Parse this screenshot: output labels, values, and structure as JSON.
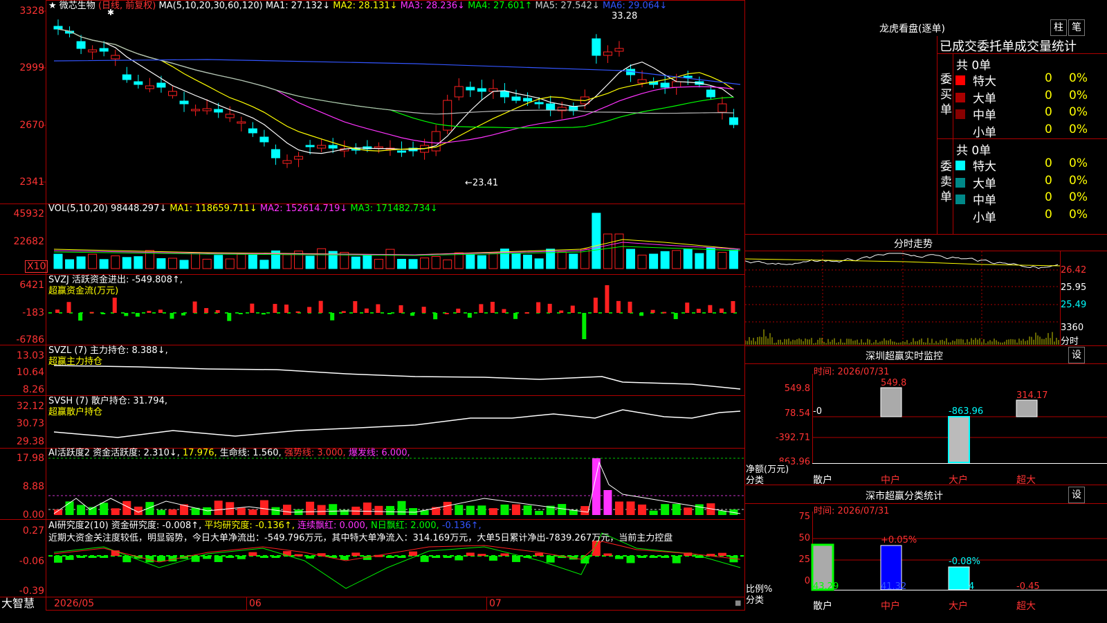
{
  "colors": {
    "up": "#ff2020",
    "down": "#00ffff",
    "grid": "#b00000",
    "green": "#00ff00",
    "yellow": "#ffff00",
    "magenta": "#ff33ff",
    "white": "#ffffff"
  },
  "kline": {
    "title": "微芯生物",
    "mode": "(日线, 前复权)",
    "ma_label": "MA(5,10,20,30,60,120)",
    "ma1": "MA1: 27.132↓",
    "ma2": "MA2: 28.131↓",
    "ma3": "MA3: 28.236↓",
    "ma4": "MA4: 27.601↑",
    "ma5": "MA5: 27.542↓",
    "ma6": "MA6: 29.064↓",
    "y_ticks": [
      "3328",
      "2999",
      "2670",
      "2341"
    ],
    "high_mark": "33.28",
    "low_mark": "←23.41"
  },
  "volume": {
    "label": "VOL(5,10,20)",
    "value": "98448.297↓",
    "ma1": "MA1: 118659.711↓",
    "ma2": "MA2: 152614.719↓",
    "ma3": "MA3: 171482.734↓",
    "y_ticks": [
      "45932",
      "22682"
    ],
    "unit": "X10"
  },
  "fund_flow": {
    "label": "SVZJ  活跃资金进出: -549.808↑,",
    "sub": "超赢资金流(万元)",
    "y_ticks": [
      "6421",
      "-183",
      "-6786"
    ]
  },
  "main_pos": {
    "label": "SVZL (7) 主力持仓: 8.388↓,",
    "sub": "超赢主力持仓",
    "y_ticks": [
      "13.03",
      "10.64",
      "8.26"
    ]
  },
  "retail_pos": {
    "label": "SVSH (7) 散户持仓: 31.794,",
    "sub": "超赢散户持仓",
    "y_ticks": [
      "32.12",
      "30.73",
      "29.38"
    ]
  },
  "activity": {
    "a": "AI活跃度2 资金活跃度: 2.310↓,",
    "b": "17.976,",
    "c": "生命线: 1.560,",
    "d": "强势线: 3.000,",
    "e": "爆发线: 6.000,",
    "y_ticks": [
      "17.98",
      "8.88",
      "0.00"
    ]
  },
  "research": {
    "a": "AI研究度2(10) 资金研究度: -0.008↑,",
    "b": "平均研究度: -0.136↑,",
    "c": "连续飘红: 0.000,",
    "d": "N日飘红: 2.000,",
    "e": "-0.136↑,",
    "commentary": "近期大资金关注度较低，明显弱势，今日大单净流出：-549.796万元，其中特大单净流入：314.169万元，大单5日累计净出-7839.267万元，当前主力控盘",
    "y_ticks": [
      "0.27",
      "-0.06",
      "-0.39"
    ]
  },
  "bottom": {
    "brand": "大智慧",
    "dates": [
      "2026/05",
      "06",
      "07"
    ]
  },
  "dragon_tiger": {
    "title": "龙虎看盘(逐单)",
    "btn_a": "柱",
    "btn_b": "笔",
    "header": "已成交委托单成交量统计",
    "buy_label": "委买单",
    "sell_label": "委卖单",
    "buy_total": "共 0单",
    "sell_total": "共 0单",
    "buy_rows": [
      {
        "name": "特大",
        "n": "0",
        "p": "0%"
      },
      {
        "name": "大单",
        "n": "0",
        "p": "0%"
      },
      {
        "name": "中单",
        "n": "0",
        "p": "0%"
      },
      {
        "name": "小单",
        "n": "0",
        "p": "0%"
      }
    ],
    "sell_rows": [
      {
        "name": "特大",
        "n": "0",
        "p": "0%"
      },
      {
        "name": "大单",
        "n": "0",
        "p": "0%"
      },
      {
        "name": "中单",
        "n": "0",
        "p": "0%"
      },
      {
        "name": "小单",
        "n": "0",
        "p": "0%"
      }
    ]
  },
  "intraday": {
    "title": "分时走势",
    "y_ticks": [
      "26.42",
      "25.95",
      "25.49"
    ],
    "vol_label": "3360",
    "vol_unit": "分时"
  },
  "sz_monitor": {
    "title": "深圳超赢实时监控",
    "btn": "设",
    "time": "时间: 2026/07/31",
    "y_ticks": [
      "549.8",
      "78.54",
      "-392.71",
      "-863.96"
    ],
    "ylabel": "净额(万元)",
    "xlabel": "分类",
    "categories": [
      "散户",
      "中户",
      "大户",
      "超大"
    ],
    "values": [
      "-0",
      "549.8",
      "-863.96",
      "314.17"
    ]
  },
  "sz_class": {
    "title": "深市超赢分类统计",
    "btn": "设",
    "time": "时间: 2026/07/31",
    "y_ticks": [
      "75",
      "50",
      "25",
      "0"
    ],
    "ylabel": "比例%",
    "xlabel": "分类",
    "categories": [
      "散户",
      "中户",
      "大户",
      "超大"
    ],
    "values": [
      "43.29",
      "41.32",
      "15.84",
      "-0.45"
    ],
    "changes": [
      "",
      "+0.05%",
      "-0.08%",
      ""
    ]
  }
}
